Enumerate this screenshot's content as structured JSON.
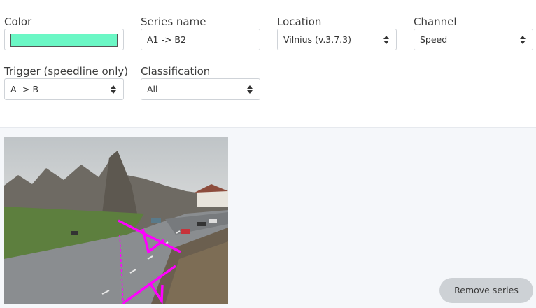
{
  "form": {
    "color": {
      "label": "Color",
      "value": "#6bf7c5"
    },
    "series_name": {
      "label": "Series name",
      "value": "A1 -> B2"
    },
    "location": {
      "label": "Location",
      "value": "Vilnius (v.3.7.3)"
    },
    "channel": {
      "label": "Channel",
      "value": "Speed"
    },
    "trigger": {
      "label": "Trigger (speedline only)",
      "value": "A -> B"
    },
    "classification": {
      "label": "Classification",
      "value": "All"
    }
  },
  "preview": {
    "line_color": "#ff00ff"
  },
  "actions": {
    "remove_label": "Remove series"
  }
}
